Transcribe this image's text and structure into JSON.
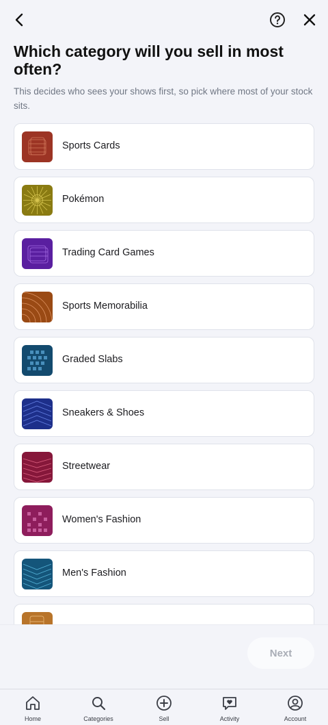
{
  "header": {
    "title": "Which category will you sell in most often?",
    "subtitle": "This decides who sees your shows first, so pick where most of your stock sits."
  },
  "categories": [
    {
      "label": "Sports Cards",
      "color": "#9c3424"
    },
    {
      "label": "Pokémon",
      "color": "#8a7b12"
    },
    {
      "label": "Trading Card Games",
      "color": "#5a1fa0"
    },
    {
      "label": "Sports Memorabilia",
      "color": "#9a4a14"
    },
    {
      "label": "Graded Slabs",
      "color": "#134a6e"
    },
    {
      "label": "Sneakers & Shoes",
      "color": "#1d2f8a"
    },
    {
      "label": "Streetwear",
      "color": "#86173a"
    },
    {
      "label": "Women's Fashion",
      "color": "#8e1d5c"
    },
    {
      "label": "Men's Fashion",
      "color": "#14557a"
    },
    {
      "label": "",
      "color": "#b8742a"
    }
  ],
  "footer": {
    "next_label": "Next"
  },
  "tabs": [
    {
      "label": "Home",
      "icon": "home-icon"
    },
    {
      "label": "Categories",
      "icon": "search-icon"
    },
    {
      "label": "Sell",
      "icon": "plus-circle-icon"
    },
    {
      "label": "Activity",
      "icon": "heart-chat-icon"
    },
    {
      "label": "Account",
      "icon": "account-icon"
    }
  ]
}
